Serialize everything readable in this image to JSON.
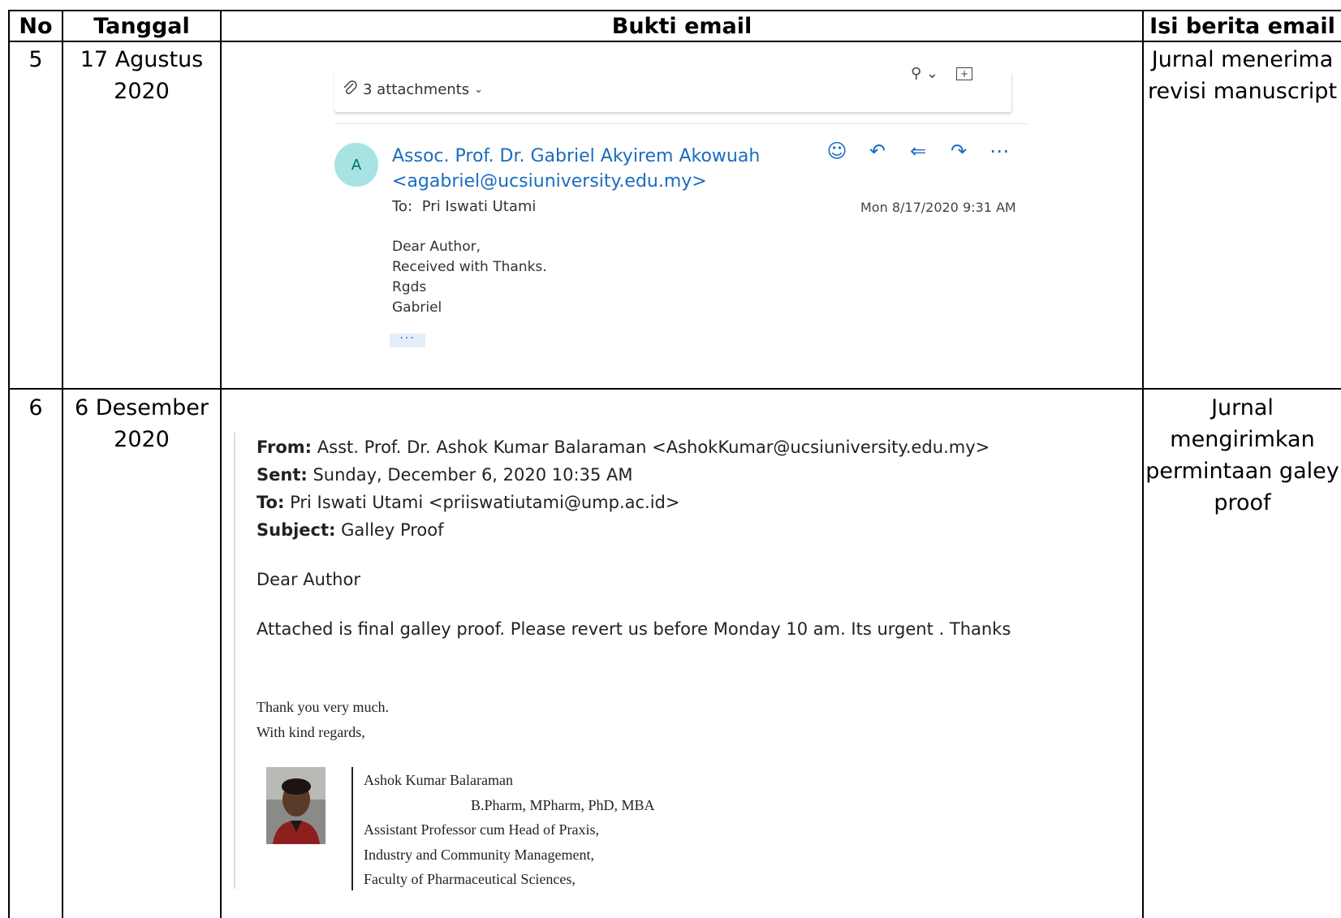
{
  "table": {
    "headers": [
      "No",
      "Tanggal",
      "Bukti email",
      "Isi berita email"
    ],
    "rows": [
      {
        "no": "5",
        "date_line1": "17 Agustus",
        "date_line2": "2020",
        "desc_line1": "Jurnal menerima",
        "desc_line2": "revisi manuscript"
      },
      {
        "no": "6",
        "date_line1": "6 Desember",
        "date_line2": "2020",
        "desc_line1": "Jurnal",
        "desc_line2": "mengirimkan",
        "desc_line3": "permintaan galey",
        "desc_line4": "proof"
      }
    ]
  },
  "email1": {
    "attachments_label": "3 attachments",
    "avatar_initial": "A",
    "sender_name": "Assoc. Prof. Dr. Gabriel Akyirem Akowuah",
    "sender_email": "<agabriel@ucsiuniversity.edu.my>",
    "to_label": "To:",
    "to_name": "Pri Iswati Utami",
    "date": "Mon 8/17/2020 9:31 AM",
    "body": [
      "Dear Author,",
      "Received with Thanks.",
      "Rgds",
      "Gabriel"
    ],
    "more_label": "···"
  },
  "email2": {
    "from_label": "From:",
    "from_value": "Asst. Prof. Dr. Ashok Kumar Balaraman <AshokKumar@ucsiuniversity.edu.my>",
    "sent_label": "Sent:",
    "sent_value": "Sunday, December 6, 2020 10:35 AM",
    "to_label": "To:",
    "to_value": "Pri Iswati Utami <priiswatiutami@ump.ac.id>",
    "subject_label": "Subject:",
    "subject_value": "Galley Proof",
    "greeting": "Dear Author",
    "message": "Attached is final galley proof. Please revert us before Monday 10 am. Its urgent . Thanks",
    "closing": [
      "Thank you very much.",
      "With kind regards,"
    ],
    "signature": [
      "Ashok Kumar Balaraman",
      "B.Pharm, MPharm, PhD, MBA",
      "Assistant Professor cum Head of  Praxis,",
      "Industry and Community Management,",
      "Faculty of  Pharmaceutical Sciences,"
    ]
  },
  "colors": {
    "link_blue": "#1a6cbf",
    "avatar_bg": "#a8e3e3",
    "avatar_fg": "#036b6b"
  }
}
